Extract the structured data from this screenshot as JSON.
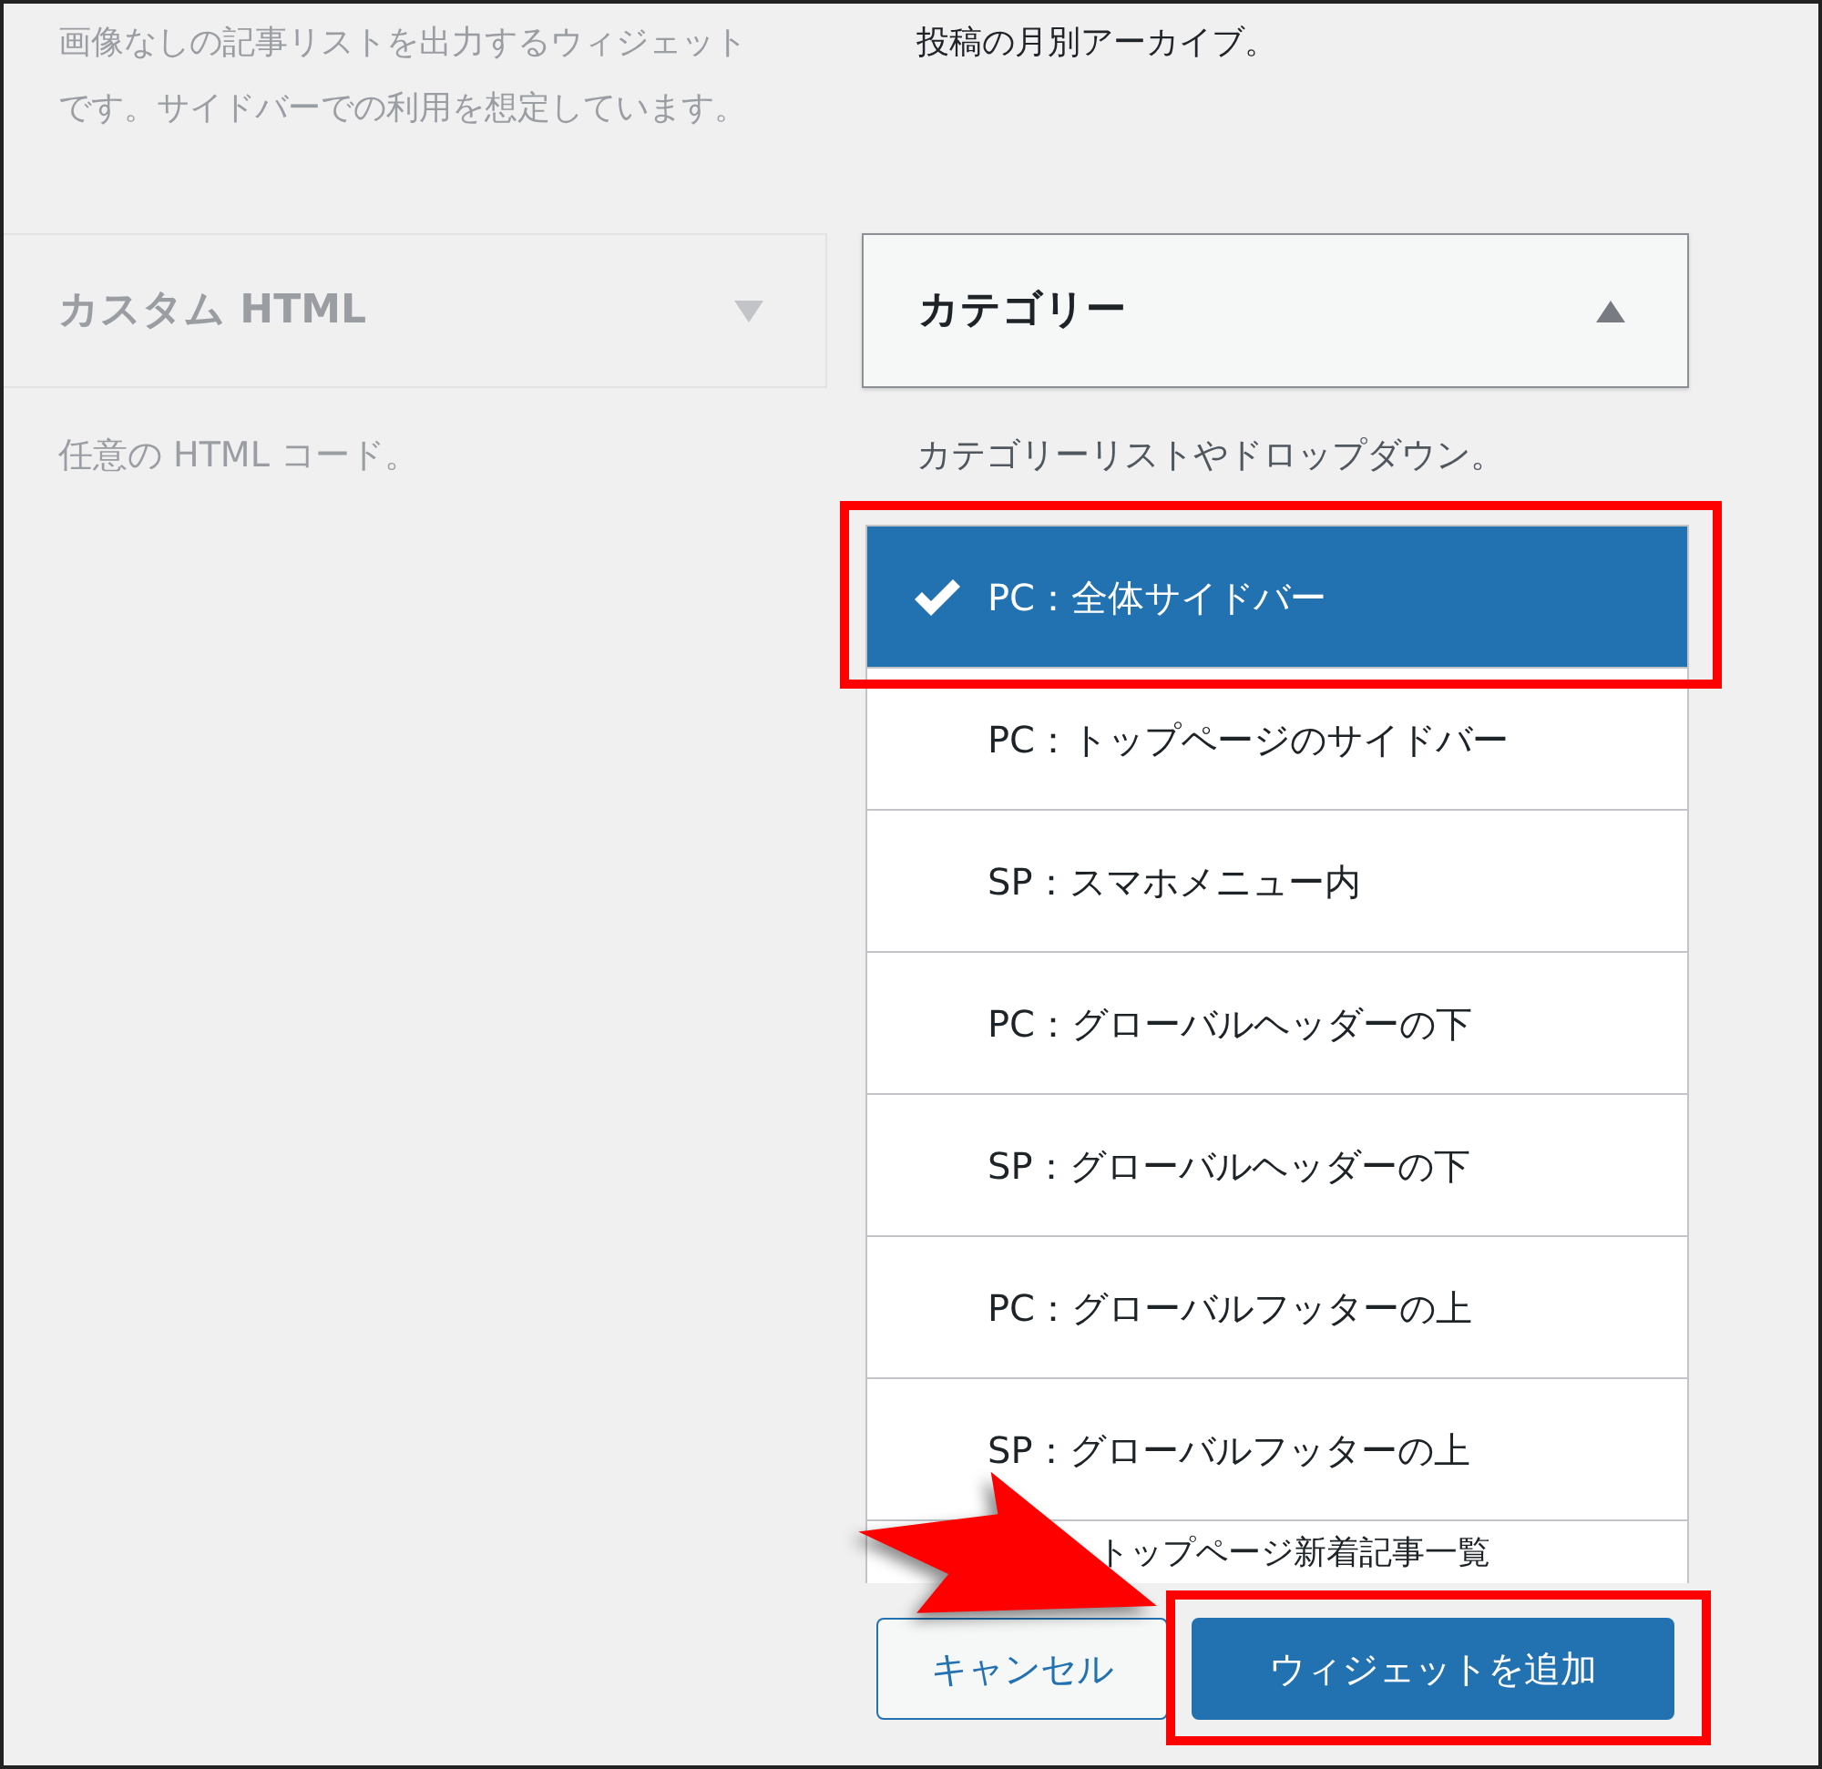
{
  "left_column": {
    "description": "画像なしの記事リストを出力するウィジェットです。サイドバーでの利用を想定しています。",
    "widget": {
      "title": "カスタム HTML",
      "expanded": false
    },
    "widget_description": "任意の HTML コード。"
  },
  "right_column": {
    "description": "投稿の月別アーカイブ。",
    "widget": {
      "title": "カテゴリー",
      "expanded": true
    },
    "widget_description": "カテゴリーリストやドロップダウン。",
    "areas": [
      {
        "label": "PC：全体サイドバー",
        "selected": true,
        "kind": "option"
      },
      {
        "label": "PC：トップページのサイドバー",
        "selected": false,
        "kind": "option"
      },
      {
        "label": "SP：スマホメニュー内",
        "selected": false,
        "kind": "option"
      },
      {
        "label": "PC：グローバルヘッダーの下",
        "selected": false,
        "kind": "option"
      },
      {
        "label": "SP：グローバルヘッダーの下",
        "selected": false,
        "kind": "option"
      },
      {
        "label": "PC：グローバルフッターの上",
        "selected": false,
        "kind": "option"
      },
      {
        "label": "SP：グローバルフッターの上",
        "selected": false,
        "kind": "option"
      },
      {
        "label": "トップページ新着記事一覧",
        "selected": false,
        "kind": "cut"
      }
    ],
    "buttons": [
      {
        "label": "キャンセル",
        "kind": "secondary"
      },
      {
        "label": "ウィジェットを追加",
        "kind": "primary"
      }
    ]
  }
}
